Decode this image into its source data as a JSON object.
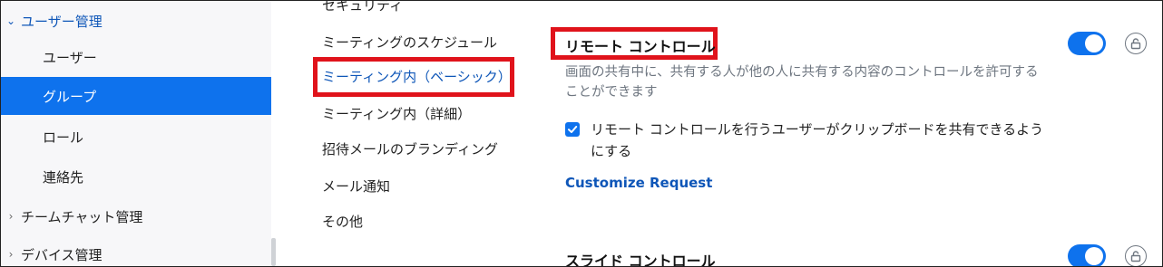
{
  "sidebar": {
    "sections": [
      {
        "label": "ユーザー管理",
        "expanded": true
      },
      {
        "label": "チームチャット管理",
        "expanded": false
      },
      {
        "label": "デバイス管理",
        "expanded": false
      }
    ],
    "items": [
      {
        "label": "ユーザー",
        "active": false
      },
      {
        "label": "グループ",
        "active": true
      },
      {
        "label": "ロール",
        "active": false
      },
      {
        "label": "連絡先",
        "active": false
      }
    ]
  },
  "subnav": {
    "items": [
      {
        "label": "セキュリティ"
      },
      {
        "label": "ミーティングのスケジュール"
      },
      {
        "label": "ミーティング内（ベーシック）",
        "active": true
      },
      {
        "label": "ミーティング内（詳細）"
      },
      {
        "label": "招待メールのブランディング"
      },
      {
        "label": "メール通知"
      },
      {
        "label": "その他"
      }
    ]
  },
  "settings": {
    "remote_control": {
      "title": "リモート コントロール",
      "description": "画面の共有中に、共有する人が他の人に共有する内容のコントロールを許可することができます",
      "checkbox_label": "リモート コントロールを行うユーザーがクリップボードを共有できるようにする",
      "checkbox_checked": true,
      "link": "Customize Request",
      "enabled": true
    },
    "slide_control": {
      "title": "スライド コントロール",
      "enabled": true
    }
  },
  "colors": {
    "accent": "#0e72ed",
    "link": "#0e56b8",
    "highlight_box": "#e0131b"
  },
  "icons": {
    "chevron_open": "chevron-down-icon",
    "chevron_closed": "chevron-right-icon",
    "lock": "unlock-icon",
    "check": "check-icon"
  }
}
